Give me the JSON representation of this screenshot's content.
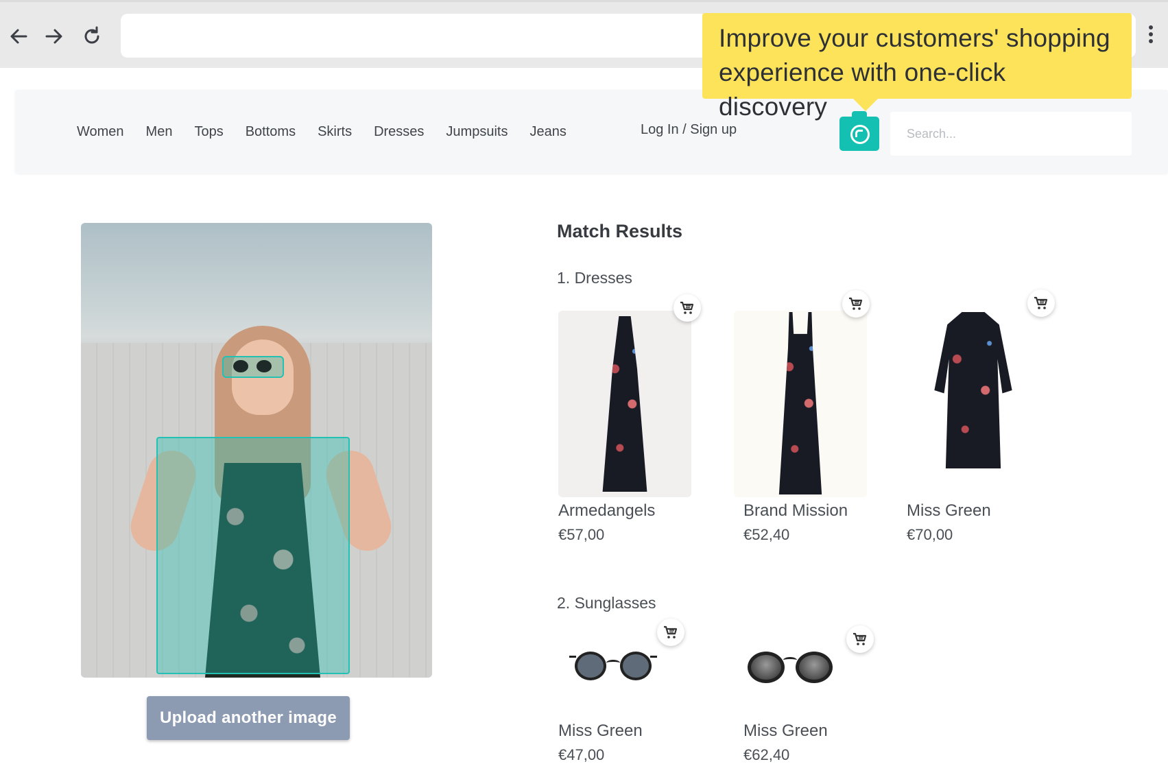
{
  "browser": {
    "back_icon": "arrow-left-icon",
    "forward_icon": "arrow-right-icon",
    "reload_icon": "reload-icon",
    "address_value": ""
  },
  "tooltip": {
    "line1": "Improve your customers' shopping",
    "line2": "experience with one-click discovery",
    "color": "#fde35a"
  },
  "header": {
    "nav": [
      "Women",
      "Men",
      "Tops",
      "Bottoms",
      "Skirts",
      "Dresses",
      "Jumpsuits",
      "Jeans"
    ],
    "login": "Log In / Sign up",
    "search_placeholder": "Search...",
    "accent": "#14c0b2"
  },
  "upload": {
    "label": "Upload another image"
  },
  "results": {
    "title": "Match Results",
    "sections": [
      {
        "label": "1. Dresses",
        "items": [
          {
            "name": "Armedangels",
            "price": "€57,00"
          },
          {
            "name": "Brand Mission",
            "price": "€52,40"
          },
          {
            "name": "Miss Green",
            "price": "€70,00"
          }
        ]
      },
      {
        "label": "2. Sunglasses",
        "items": [
          {
            "name": "Miss Green",
            "price": "€47,00"
          },
          {
            "name": "Miss Green",
            "price": "€62,40"
          }
        ]
      }
    ]
  }
}
